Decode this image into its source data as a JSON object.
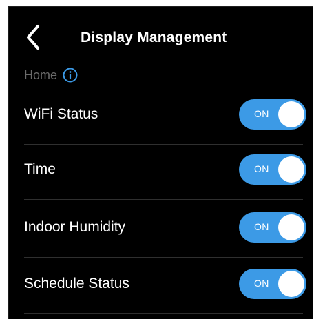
{
  "header": {
    "title": "Display Management",
    "back_icon": "chevron-left-icon"
  },
  "breadcrumb": {
    "label": "Home",
    "info_icon": "info-circle-icon"
  },
  "colors": {
    "background": "#000000",
    "accent": "#3c9ae6",
    "muted_text": "#6b6b6b",
    "divider": "#2f2f2f"
  },
  "settings": [
    {
      "label": "WiFi Status",
      "toggle_text": "ON",
      "enabled": true
    },
    {
      "label": "Time",
      "toggle_text": "ON",
      "enabled": true
    },
    {
      "label": "Indoor Humidity",
      "toggle_text": "ON",
      "enabled": true
    },
    {
      "label": "Schedule Status",
      "toggle_text": "ON",
      "enabled": true
    }
  ]
}
